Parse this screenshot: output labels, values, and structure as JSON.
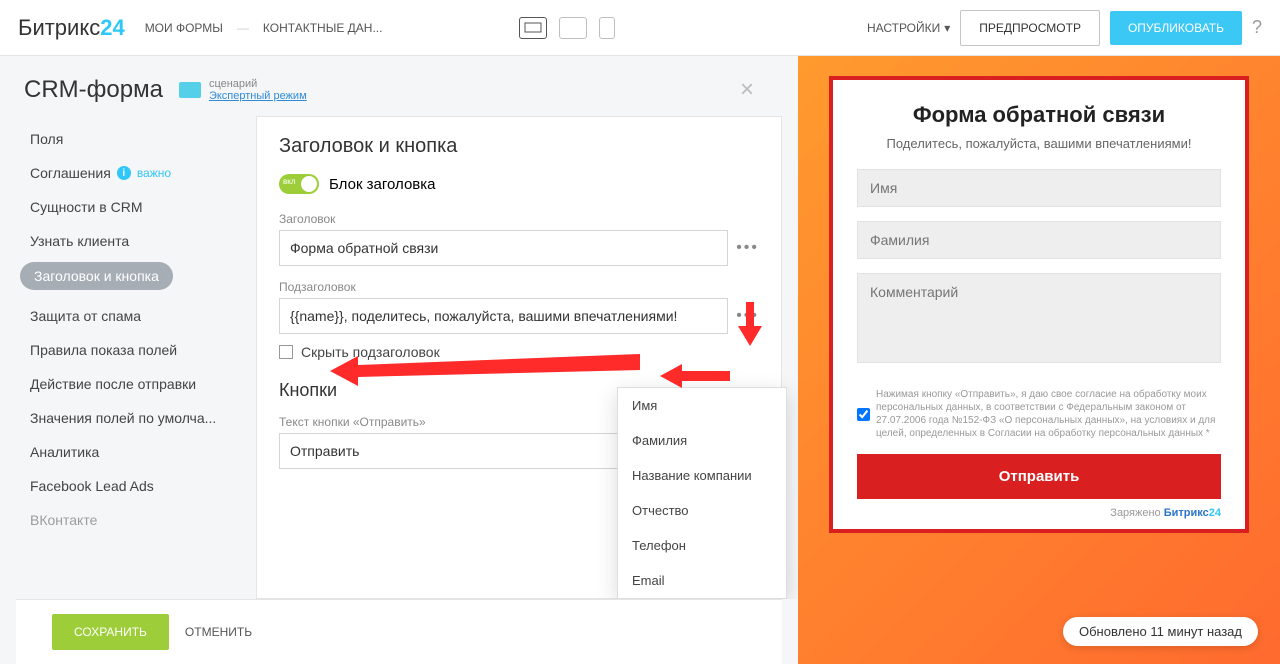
{
  "logo": {
    "brand": "Битрикс",
    "num": "24"
  },
  "breadcrumb": {
    "a": "МОИ ФОРМЫ",
    "b": "КОНТАКТНЫЕ ДАН..."
  },
  "topbar": {
    "settings": "НАСТРОЙКИ",
    "preview": "ПРЕДПРОСМОТР",
    "publish": "ОПУБЛИКОВАТЬ",
    "help": "?"
  },
  "editor": {
    "title": "CRM-форма",
    "mode_label": "сценарий",
    "mode_link": "Экспертный режим"
  },
  "sidebar": {
    "items": [
      "Поля",
      "Соглашения",
      "Сущности в CRM",
      "Узнать клиента",
      "Заголовок и кнопка",
      "Защита от спама",
      "Правила показа полей",
      "Действие после отправки",
      "Значения полей по умолча...",
      "Аналитика",
      "Facebook Lead Ads",
      "ВКонтакте"
    ],
    "info_text": "важно"
  },
  "panel": {
    "heading": "Заголовок и кнопка",
    "toggle_inner": "вкл",
    "toggle_label": "Блок заголовка",
    "title_label": "Заголовок",
    "title_value": "Форма обратной связи",
    "subtitle_label": "Подзаголовок",
    "subtitle_value": "{{name}}, поделитесь, пожалуйста, вашими впечатлениями!",
    "hide_sub": "Скрыть подзаголовок",
    "buttons_heading": "Кнопки",
    "submit_text_label": "Текст кнопки «Отправить»",
    "submit_text_value": "Отправить"
  },
  "popup": {
    "items": [
      "Имя",
      "Фамилия",
      "Название компании",
      "Отчество",
      "Телефон",
      "Email"
    ]
  },
  "footer": {
    "save": "СОХРАНИТЬ",
    "cancel": "ОТМЕНИТЬ"
  },
  "preview": {
    "title": "Форма обратной связи",
    "subtitle": "Поделитесь, пожалуйста, вашими впечатлениями!",
    "ph_name": "Имя",
    "ph_surname": "Фамилия",
    "ph_comment": "Комментарий",
    "consent": "Нажимая кнопку «Отправить», я даю свое согласие на обработку моих персональных данных, в соответствии с Федеральным законом от 27.07.2006 года №152-ФЗ «О персональных данных», на условиях и для целей, определенных в Согласии на обработку персональных данных *",
    "submit": "Отправить",
    "powered_pre": "Заряжено ",
    "powered_brand": "Битрикс",
    "powered_num": "24"
  },
  "status": "Обновлено 11 минут назад"
}
